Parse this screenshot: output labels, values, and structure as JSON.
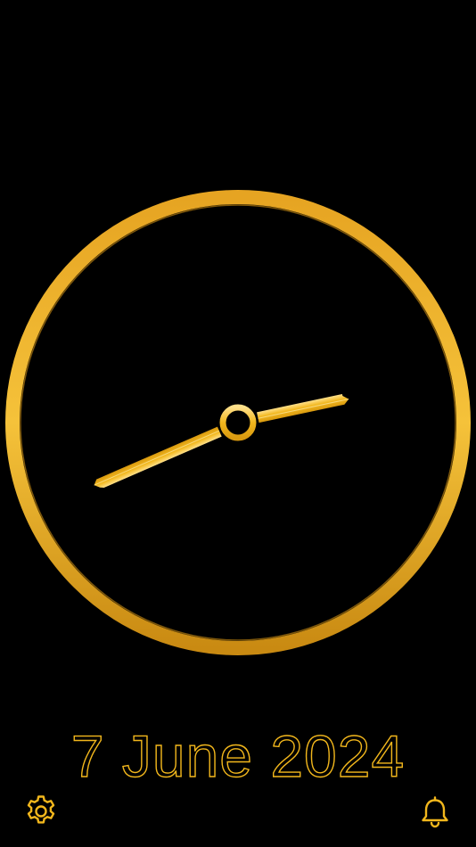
{
  "clock": {
    "hour": 8,
    "minute": 13,
    "accent_color": "#f2b71c",
    "ring_color": "#e0a21a"
  },
  "date_text": "7 June 2024",
  "icons": {
    "settings": "gear-icon",
    "alarm": "bell-icon"
  }
}
